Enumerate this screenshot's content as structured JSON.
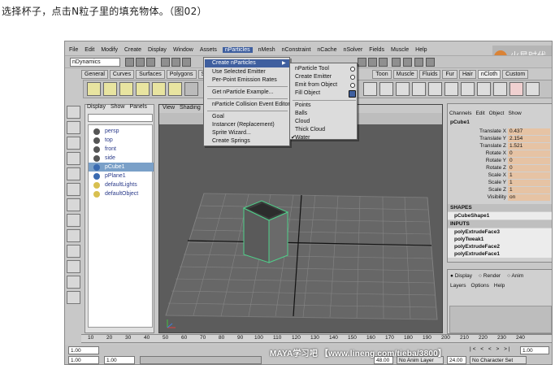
{
  "caption": "选择杯子，点击N粒子里的填充物体。（图02）",
  "menubar": [
    "File",
    "Edit",
    "Modify",
    "Create",
    "Display",
    "Window",
    "Assets",
    "nParticles",
    "nMesh",
    "nConstraint",
    "nCache",
    "nSolver",
    "Fields",
    "Muscle",
    "Help"
  ],
  "menuset": "nDynamics",
  "shelf_tabs": [
    "General",
    "Curves",
    "Surfaces",
    "Polygons",
    "Subdivs",
    "Toon",
    "Muscle",
    "Fluids",
    "Fur",
    "Hair",
    "nCloth",
    "Custom"
  ],
  "nparticles_menu": [
    {
      "label": "Create nParticles",
      "arrow": "▶"
    },
    {
      "label": "Use Selected Emitter"
    },
    {
      "label": "Per-Point Emission Rates"
    },
    {
      "label": "Get nParticle Example..."
    },
    {
      "label": "nParticle Collision Event Editor"
    },
    {
      "label": "Goal"
    },
    {
      "label": "Instancer (Replacement)"
    },
    {
      "label": "Sprite Wizard..."
    },
    {
      "label": "Create Springs"
    }
  ],
  "create_submenu": [
    "nParticle Tool",
    "Create Emitter",
    "Emit from Object",
    "Fill Object",
    "Points",
    "Balls",
    "Cloud",
    "Thick Cloud",
    "Water"
  ],
  "outliner": {
    "menu": [
      "Display",
      "Show",
      "Panels"
    ],
    "items": [
      "persp",
      "top",
      "front",
      "side",
      "pCube1",
      "pPlane1",
      "defaultLights",
      "defaultObject"
    ],
    "selected": "pCube1"
  },
  "view_menu": [
    "View",
    "Shading"
  ],
  "channel_box": {
    "menu": [
      "Channels",
      "Edit",
      "Object",
      "Show"
    ],
    "object": "pCube1",
    "channels": [
      {
        "name": "Translate X",
        "value": "0.437"
      },
      {
        "name": "Translate Y",
        "value": "2.154"
      },
      {
        "name": "Translate Z",
        "value": "1.521"
      },
      {
        "name": "Rotate X",
        "value": "0"
      },
      {
        "name": "Rotate Y",
        "value": "0"
      },
      {
        "name": "Rotate Z",
        "value": "0"
      },
      {
        "name": "Scale X",
        "value": "1"
      },
      {
        "name": "Scale Y",
        "value": "1"
      },
      {
        "name": "Scale Z",
        "value": "1"
      },
      {
        "name": "Visibility",
        "value": "on"
      }
    ],
    "shapes_label": "SHAPES",
    "shape": "pCubeShape1",
    "inputs_label": "INPUTS",
    "inputs": [
      "polyExtrudeFace3",
      "polyTweak1",
      "polyExtrudeFace2",
      "polyExtrudeFace1"
    ]
  },
  "layer_editor": {
    "options": [
      "Display",
      "Render",
      "Anim"
    ],
    "menu": [
      "Layers",
      "Options",
      "Help"
    ]
  },
  "timeline_ticks": [
    "10",
    "20",
    "30",
    "40",
    "50",
    "60",
    "70",
    "80",
    "90",
    "100",
    "110",
    "120",
    "130",
    "140",
    "150",
    "160",
    "170",
    "180",
    "190",
    "200",
    "210",
    "220",
    "230",
    "240"
  ],
  "range": {
    "start": "1.00",
    "current": "1.00",
    "end1": "24.00",
    "end2": "48.00",
    "anim_layer": "No Anim Layer",
    "char_set": "No Character Set"
  },
  "watermark": "MAYA学习吧 【www.lineng.com/tieba/3800】",
  "colors": {
    "highlight": "#3f5f9f",
    "channel": "#e6c3a4",
    "cube": "#4fd08a"
  }
}
